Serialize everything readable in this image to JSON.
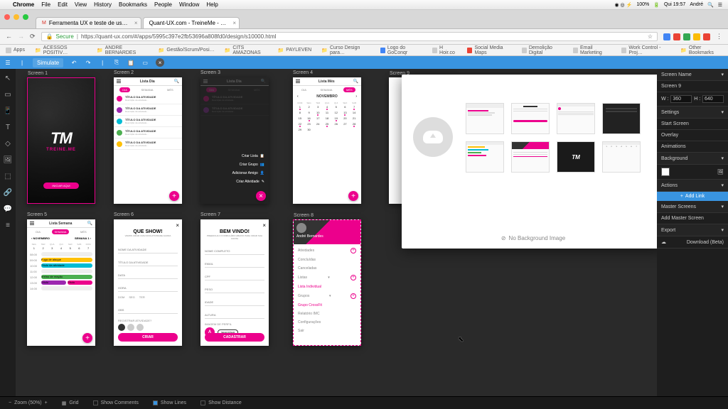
{
  "mac_menu": {
    "app": "Chrome",
    "items": [
      "File",
      "Edit",
      "View",
      "History",
      "Bookmarks",
      "People",
      "Window",
      "Help"
    ],
    "right": [
      "100%",
      "Qui 19:57",
      "André"
    ]
  },
  "browser": {
    "tabs": [
      {
        "label": "Ferramenta UX e teste de us…",
        "active": false
      },
      {
        "label": "Quant-UX.com - TreineMe - …",
        "active": true
      }
    ],
    "url_secure": "Secure",
    "url": "https://quant-ux.com/#/apps/5995c397e2fb53696a808fd0/design/s10000.html",
    "bookmarks": [
      "Apps",
      "ACESSOS POSITIV…",
      "ANDRE BERNARDES",
      "Gestão/Scrum/Posi…",
      "CITS AMAZONAS",
      "PAYLEVEN",
      "Curso Design para…",
      "Logo do GoConqr",
      "H Hoir.co",
      "Social Media Maps",
      "Demolição Digital",
      "Email Marketing",
      "Work Control - Proj…"
    ],
    "other_bookmarks": "Other Bookmarks"
  },
  "toolbar": {
    "simulate": "Simulate"
  },
  "right_panel": {
    "screen_name_label": "Screen Name",
    "screen_name_value": "Screen 9",
    "w_label": "W :",
    "w_value": "360",
    "h_label": "H :",
    "h_value": "640",
    "settings": "Settings",
    "start_screen": "Start Screen",
    "overlay": "Overlay",
    "animations": "Animations",
    "background": "Background",
    "actions": "Actions",
    "add_link": "Add Link",
    "master_screens": "Master Screens",
    "add_master": "Add Master Screen",
    "export": "Export",
    "download": "Download (Beta)"
  },
  "modal": {
    "no_bg": "No Background Image"
  },
  "bottom": {
    "zoom": "Zoom (50%)",
    "grid": "Grid",
    "comments": "Show Comments",
    "lines": "Show Lines",
    "distance": "Show Distance"
  },
  "screens": {
    "labels": [
      "Screen 1",
      "Screen 2",
      "Screen 3",
      "Screen 4",
      "Screen 9",
      "Screen 5",
      "Screen 6",
      "Screen 7",
      "Screen 8"
    ],
    "s1_brand": "TREINE.ME",
    "s1_btn": "INICIAR AQUI",
    "s2_title": "Lista Dia",
    "s4_title": "Lista Més",
    "s5_title": "Lista Semana",
    "tab_dia": "DIA",
    "tab_semana": "SEMANA",
    "tab_mes": "MÉS",
    "activity_title": "TÍTULO DA ATIVIDADE",
    "activity_sub": "Descrição da atividade…",
    "s3_create_list": "Criar Lista",
    "s3_create_group": "Criar Grupo",
    "s3_add_friend": "Adicionar Amigo",
    "s3_create_activity": "Criar Atividade",
    "s4_month": "NOVEMBRO",
    "s5_week": "SEMANA 1",
    "cal_days": [
      "DOM",
      "SEG",
      "TER",
      "QUA",
      "QUI",
      "SEX",
      "SAB"
    ],
    "cal_nums": [
      "1",
      "2",
      "3",
      "4",
      "5",
      "6",
      "7",
      "8",
      "9",
      "10",
      "11",
      "12",
      "13",
      "14",
      "15",
      "16",
      "17",
      "18",
      "19",
      "20",
      "21",
      "22",
      "23",
      "24",
      "25",
      "26",
      "27",
      "28",
      "29",
      "30"
    ],
    "wk_days": [
      "SEG",
      "TER",
      "QUA",
      "QUI",
      "SEX",
      "SAB",
      "DOM"
    ],
    "wk_nums": [
      "1",
      "2",
      "3",
      "4",
      "5",
      "6",
      "7"
    ],
    "wk_times": [
      "08:00",
      "09:00",
      "10:00",
      "11:00",
      "12:00",
      "13:00",
      "14:00"
    ],
    "s6_title": "QUE SHOW!",
    "s6_sub": "VAMOS CRIAR UMA NOVA ATIVIDADE AGORA",
    "s6_fields": [
      "NOME DA ATIVIDADE",
      "TÍTULO DA ATIVIDADE",
      "DATA",
      "HORA",
      "OBS"
    ],
    "s6_d": "DOM",
    "s6_s": "SEG",
    "s6_t": "TER",
    "s6_btn": "CRIAR",
    "s7_title": "BEM VINDO!",
    "s7_sub": "PREENCHA O FORMULÁRIO ABAIXO PARA CRIAR SUA CONTA",
    "s7_fields": [
      "NOME COMPLETO",
      "EMAIL",
      "CPF",
      "PESO",
      "IDADE",
      "ALTURA"
    ],
    "s7_img": "IMAGEM DE PERFIL",
    "s7_sel": "SELECIONAR",
    "s7_btn": "CADASTRAR",
    "s8_user": "André Bernardes",
    "s8_items": [
      "Atividades",
      "Concluídas",
      "Canceladas",
      "Listas",
      "Lista Individual",
      "Grupos",
      "Grupo CrossFit",
      "Relatório IMC",
      "Configurações",
      "Sair"
    ]
  }
}
